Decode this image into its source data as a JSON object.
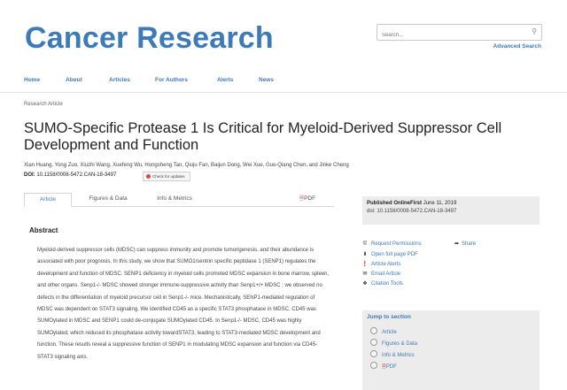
{
  "header": {
    "logo": "Cancer Research",
    "search_placeholder": "Search...",
    "advanced_search": "Advanced Search",
    "search_icon": "search-icon"
  },
  "nav": {
    "items": [
      {
        "label": "Home"
      },
      {
        "label": "About"
      },
      {
        "label": "Articles"
      },
      {
        "label": "For Authors"
      },
      {
        "label": "Alerts"
      },
      {
        "label": "News"
      }
    ]
  },
  "article": {
    "type": "Research Article",
    "title": "SUMO-Specific Protease 1 Is Critical for Myeloid-Derived Suppressor Cell Development and Function",
    "authors": "Xian Huang, Yong Zuo, Xiuzhi Wang, Xuefeng Wu, Hongsheng Tan, Qiuju Fan, Baijun Dong, Wei Xue, Guo-Qiang Chen, and Jinke Cheng",
    "doi_label": "DOI:",
    "doi": "10.1158/0008-5472.CAN-18-3497",
    "check_updates": "Check for updates"
  },
  "tabs": [
    {
      "label": "Article",
      "active": true
    },
    {
      "label": "Figures & Data",
      "active": false
    },
    {
      "label": "Info & Metrics",
      "active": false
    },
    {
      "label": "PDF",
      "active": false
    }
  ],
  "abstract": {
    "heading": "Abstract",
    "text": "Myeloid-derived suppressor cells (MDSC) can suppress immunity and promote tumorigenesis, and their abundance is associated with poor prognosis. In this study, we show that SUMO1/sentrin specific peptidase 1 (SENP1) regulates the development and function of MDSC. SENP1 deficiency in myeloid cells promoted MDSC expansion in bone marrow, spleen, and other organs. Senp1-/- MDSC showed stronger immune-suppressive activity than Senp1+/+ MDSC ; we observed no defects in the differentiation of myeloid precursor cell in Senp1-/- mice. Mechanistically, SENP1-mediated regulation of MDSC was dependent on STAT3 signaling. We identified CD45 as a specific STAT3 phosphatase in MDSC. CD45 was SUMOylated in MDSC and SENP1 could de-conjugate SUMOylated CD45. In Senp1-/- MDSC, CD45 was highly SUMOylated, which reduced its phosphatase activity towardSTAT3, leading to STAT3-mediated MDSC development and function. These results reveal a suppressive function of SENP1 in modulating MDSC expansion and function via CD45-STAT3 signaling axis."
  },
  "sidebar": {
    "published_label": "Published OnlineFirst",
    "published_date": "June 11, 2019",
    "published_doi": "doi: 10.1158/0008-5472.CAN-18-3497",
    "tools": [
      {
        "label": "Request Permissions",
        "icon": "copyright-icon"
      },
      {
        "label": "Open full page PDF",
        "icon": "download-icon"
      },
      {
        "label": "Article Alerts",
        "icon": "alert-icon"
      },
      {
        "label": "Email Article",
        "icon": "email-icon"
      },
      {
        "label": "Citation Tools",
        "icon": "citation-icon"
      }
    ],
    "share": "Share",
    "jump_heading": "Jump to section",
    "jump_items": [
      {
        "label": "Article"
      },
      {
        "label": "Figures & Data"
      },
      {
        "label": "Info & Metrics"
      },
      {
        "label": "PDF"
      }
    ]
  },
  "colors": {
    "brand": "#3d7ab8",
    "sidebar_bg": "#ececec",
    "pdf_icon": "#c0392b"
  }
}
